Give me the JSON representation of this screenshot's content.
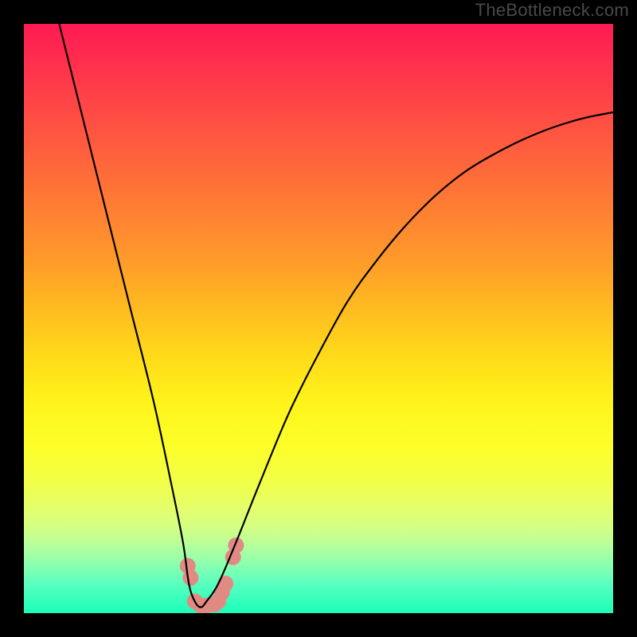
{
  "watermark": "TheBottleneck.com",
  "chart_data": {
    "type": "line",
    "title": "",
    "xlabel": "",
    "ylabel": "",
    "xlim": [
      0,
      100
    ],
    "ylim": [
      0,
      100
    ],
    "grid": false,
    "legend": false,
    "series": [
      {
        "name": "bottleneck-curve",
        "color": "#000000",
        "x": [
          6,
          10,
          14,
          18,
          22,
          25,
          27,
          28,
          29,
          30,
          31,
          33,
          36,
          40,
          45,
          50,
          55,
          60,
          65,
          70,
          75,
          80,
          85,
          90,
          95,
          100
        ],
        "y": [
          100,
          84,
          68,
          52,
          36,
          22,
          12,
          5,
          2,
          1,
          2,
          5,
          12,
          22,
          34,
          44,
          53,
          60,
          66,
          71,
          75,
          78,
          80.5,
          82.5,
          84,
          85
        ]
      }
    ],
    "markers": {
      "name": "highlight-dots",
      "color": "#e18a83",
      "size": 10,
      "x": [
        27.8,
        28.3,
        29.0,
        30.0,
        31.0,
        32.4,
        33.0,
        33.6,
        34.2,
        35.5,
        36.0
      ],
      "y": [
        8.0,
        6.0,
        2.0,
        1.3,
        1.3,
        1.5,
        2.0,
        3.5,
        5.0,
        9.5,
        11.5
      ]
    }
  }
}
